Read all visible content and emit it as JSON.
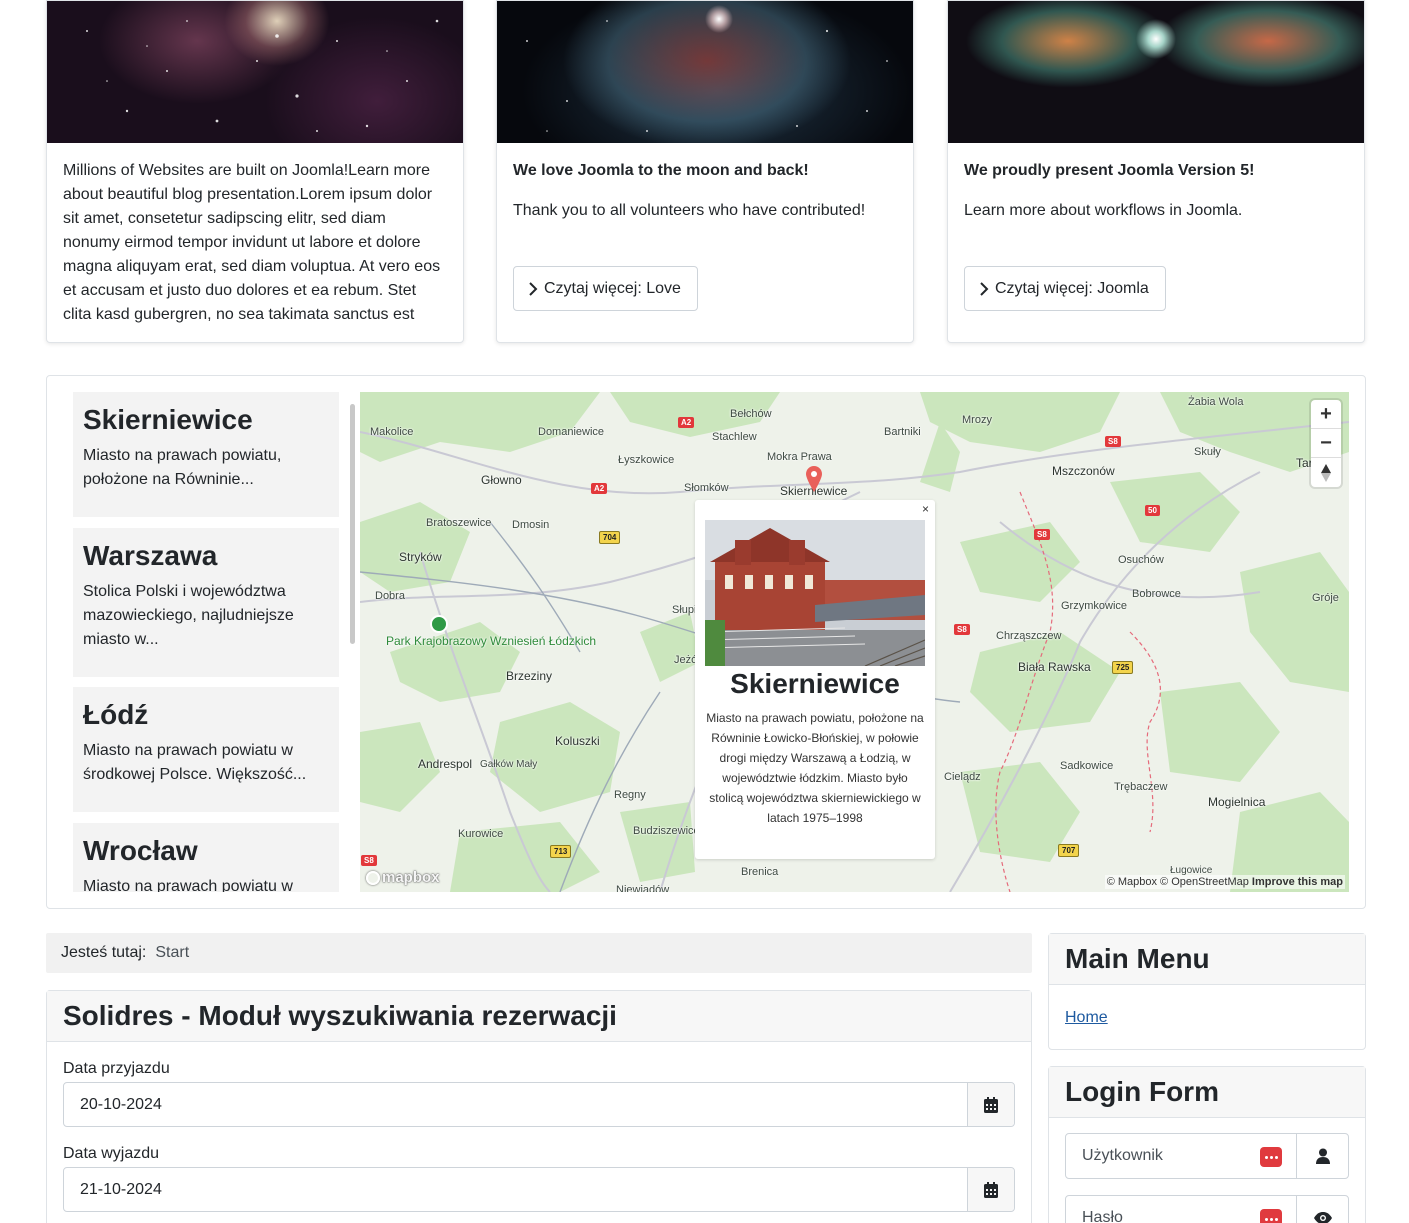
{
  "cards": [
    {
      "image": "galaxy-nebula-image",
      "heading": "",
      "text": "Millions of Websites are built on Joomla!Learn more about beautiful blog presentation.Lorem ipsum dolor sit amet, consetetur sadipscing elitr, sed diam nonumy eirmod tempor invidunt ut labore et dolore magna aliquyam erat, sed diam voluptua. At vero eos et accusam et justo duo dolores et ea rebum. Stet clita kasd gubergren, no sea takimata sanctus est",
      "button": ""
    },
    {
      "image": "red-nebula-image",
      "heading": "We love Joomla to the moon and back!",
      "text": "Thank you to all volunteers who have contributed!",
      "button": "Czytaj więcej: Love"
    },
    {
      "image": "butterfly-nebula-image",
      "heading": "We proudly present Joomla Version 5!",
      "text": "Learn more about workflows in Joomla.",
      "button": "Czytaj więcej: Joomla"
    }
  ],
  "locations": [
    {
      "name": "Skierniewice",
      "excerpt": "Miasto na prawach powiatu, położone na Równinie..."
    },
    {
      "name": "Warszawa",
      "excerpt": "Stolica Polski i województwa mazowieckiego, najludniejsze miasto w..."
    },
    {
      "name": "Łódź",
      "excerpt": "Miasto na prawach powiatu w środkowej Polsce. Większość..."
    },
    {
      "name": "Wrocław",
      "excerpt": "Miasto na prawach powiatu w"
    }
  ],
  "map": {
    "place_labels": [
      "Bełchów",
      "Makolice",
      "Domaniewice",
      "Stachlew",
      "Bartniki",
      "Mrozy",
      "Żabia Wola",
      "Łyszkowice",
      "Mokra Prawa",
      "Słomków",
      "Skierniewice",
      "Głowno",
      "Skuły",
      "Mszczonów",
      "Bratoszewice",
      "Dmosin",
      "Osuchów",
      "Stryków",
      "Dobra",
      "Bobrowce",
      "Grzymkowice",
      "Słupi",
      "Chrząszczew",
      "Biała Rawska",
      "Brzeziny",
      "Jeżów",
      "Koluszki",
      "Andrespol",
      "Gałków Mały",
      "Cielądz",
      "Sadkowice",
      "Trębaczew",
      "Mogielnica",
      "Regny",
      "Kurowice",
      "Budziszewice",
      "Brenica",
      "Ługowice",
      "Niewiadów",
      "Tar",
      "Gróje"
    ],
    "park_label": "Park Krajobrazowy Wzniesień Łódzkich",
    "road_shields": [
      "A2",
      "A2",
      "S8",
      "S8",
      "S8",
      "S8",
      "50",
      "704",
      "725",
      "713",
      "707"
    ],
    "zoom_in": "+",
    "zoom_out": "−",
    "logo_text": "mapbox",
    "attribution": "© Mapbox © OpenStreetMap",
    "improve": "Improve this map",
    "popup": {
      "close": "×",
      "title": "Skierniewice",
      "text": "Miasto na prawach powiatu, położone na Równinie Łowicko-Błońskiej, w połowie drogi między Warszawą a Łodzią, w województwie łódzkim. Miasto było stolicą województwa skierniewickiego w latach 1975–1998"
    }
  },
  "breadcrumb": {
    "label": "Jesteś tutaj:",
    "item": "Start"
  },
  "search_module": {
    "title": "Solidres - Moduł wyszukiwania rezerwacji",
    "arrival_label": "Data przyjazdu",
    "arrival_value": "20-10-2024",
    "departure_label": "Data wyjazdu",
    "departure_value": "21-10-2024"
  },
  "main_menu": {
    "title": "Main Menu",
    "items": [
      "Home"
    ]
  },
  "login_form": {
    "title": "Login Form",
    "username_placeholder": "Użytkownik",
    "password_placeholder": "Hasło"
  }
}
